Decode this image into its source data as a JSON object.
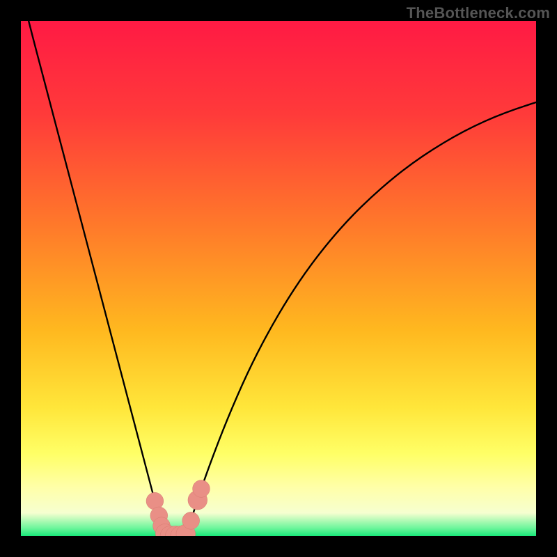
{
  "attribution": "TheBottleneck.com",
  "colors": {
    "frame": "#000000",
    "gradient_stops": [
      {
        "offset": 0.0,
        "color": "#ff1a44"
      },
      {
        "offset": 0.18,
        "color": "#ff3a3a"
      },
      {
        "offset": 0.4,
        "color": "#ff7a2a"
      },
      {
        "offset": 0.6,
        "color": "#ffb81f"
      },
      {
        "offset": 0.75,
        "color": "#ffe63a"
      },
      {
        "offset": 0.84,
        "color": "#ffff66"
      },
      {
        "offset": 0.905,
        "color": "#ffffa8"
      },
      {
        "offset": 0.955,
        "color": "#f6ffd0"
      },
      {
        "offset": 0.985,
        "color": "#6af59a"
      },
      {
        "offset": 1.0,
        "color": "#17e879"
      }
    ],
    "curve_stroke": "#000000",
    "marker_fill": "#e98f86",
    "marker_stroke": "#d67a70"
  },
  "chart_data": {
    "type": "line",
    "title": "",
    "xlabel": "",
    "ylabel": "",
    "xlim": [
      0,
      100
    ],
    "ylim": [
      0,
      100
    ],
    "x": [
      0,
      2,
      4,
      6,
      8,
      10,
      12,
      14,
      16,
      18,
      20,
      22,
      24,
      25,
      26,
      27,
      28,
      29,
      30,
      31,
      32,
      33,
      34,
      35,
      37,
      40,
      44,
      48,
      52,
      56,
      60,
      64,
      68,
      72,
      76,
      80,
      84,
      88,
      92,
      96,
      100
    ],
    "series": [
      {
        "name": "bottleneck-curve",
        "values": [
          106,
          98,
          90.4,
          82.8,
          75.2,
          67.6,
          60,
          52.4,
          44.8,
          37.2,
          29.6,
          22,
          14.4,
          10.6,
          6.8,
          3.2,
          0.4,
          0,
          0,
          0,
          0.4,
          3.0,
          6.2,
          9.2,
          14.8,
          22.6,
          31.8,
          39.6,
          46.4,
          52.3,
          57.4,
          61.9,
          65.8,
          69.3,
          72.4,
          75.1,
          77.5,
          79.6,
          81.4,
          82.9,
          84.2
        ]
      }
    ],
    "markers": {
      "name": "highlighted-points",
      "points": [
        {
          "x": 26.0,
          "y": 6.8,
          "r": 1.0
        },
        {
          "x": 26.8,
          "y": 4.0,
          "r": 1.0
        },
        {
          "x": 27.3,
          "y": 2.0,
          "r": 1.0
        },
        {
          "x": 28.0,
          "y": 0.5,
          "r": 1.2
        },
        {
          "x": 29.0,
          "y": 0.0,
          "r": 1.3
        },
        {
          "x": 30.0,
          "y": 0.0,
          "r": 1.3
        },
        {
          "x": 31.0,
          "y": 0.0,
          "r": 1.3
        },
        {
          "x": 32.0,
          "y": 0.4,
          "r": 1.2
        },
        {
          "x": 33.0,
          "y": 3.0,
          "r": 1.0
        },
        {
          "x": 34.3,
          "y": 7.0,
          "r": 1.2
        },
        {
          "x": 35.0,
          "y": 9.2,
          "r": 1.0
        }
      ]
    }
  }
}
